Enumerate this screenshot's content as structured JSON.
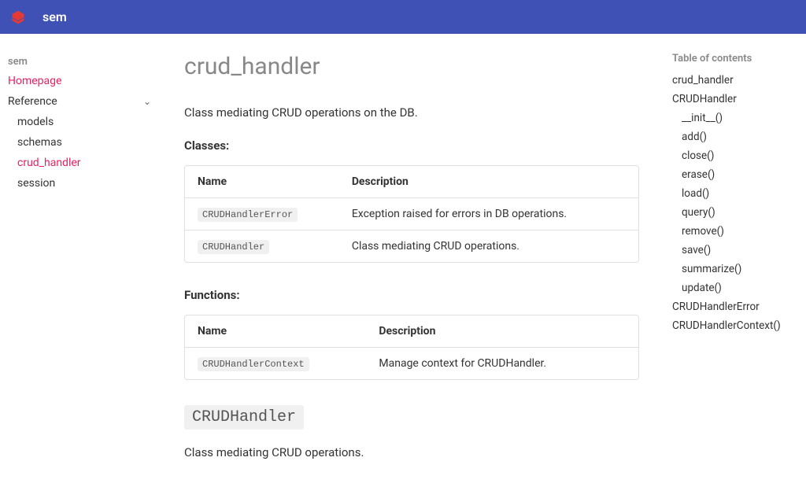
{
  "header": {
    "title": "sem"
  },
  "sidebarLeft": {
    "heading": "sem",
    "homepage": "Homepage",
    "reference": "Reference",
    "refItems": [
      "models",
      "schemas",
      "crud_handler",
      "session"
    ]
  },
  "page": {
    "title": "crud_handler",
    "lead": "Class mediating CRUD operations on the DB.",
    "classesLabel": "Classes:",
    "functionsLabel": "Functions:",
    "classesTable": {
      "headers": [
        "Name",
        "Description"
      ],
      "rows": [
        {
          "name": "CRUDHandlerError",
          "desc": "Exception raised for errors in DB operations."
        },
        {
          "name": "CRUDHandler",
          "desc": "Class mediating CRUD operations."
        }
      ]
    },
    "functionsTable": {
      "headers": [
        "Name",
        "Description"
      ],
      "rows": [
        {
          "name": "CRUDHandlerContext",
          "desc": "Manage context for CRUDHandler."
        }
      ]
    },
    "section2": {
      "heading": "CRUDHandler",
      "desc": "Class mediating CRUD operations."
    }
  },
  "toc": {
    "heading": "Table of contents",
    "items": [
      {
        "label": "crud_handler",
        "depth": 0
      },
      {
        "label": "CRUDHandler",
        "depth": 0
      },
      {
        "label": "__init__()",
        "depth": 1
      },
      {
        "label": "add()",
        "depth": 1
      },
      {
        "label": "close()",
        "depth": 1
      },
      {
        "label": "erase()",
        "depth": 1
      },
      {
        "label": "load()",
        "depth": 1
      },
      {
        "label": "query()",
        "depth": 1
      },
      {
        "label": "remove()",
        "depth": 1
      },
      {
        "label": "save()",
        "depth": 1
      },
      {
        "label": "summarize()",
        "depth": 1
      },
      {
        "label": "update()",
        "depth": 1
      },
      {
        "label": "CRUDHandlerError",
        "depth": 0
      },
      {
        "label": "CRUDHandlerContext()",
        "depth": 0
      }
    ]
  }
}
